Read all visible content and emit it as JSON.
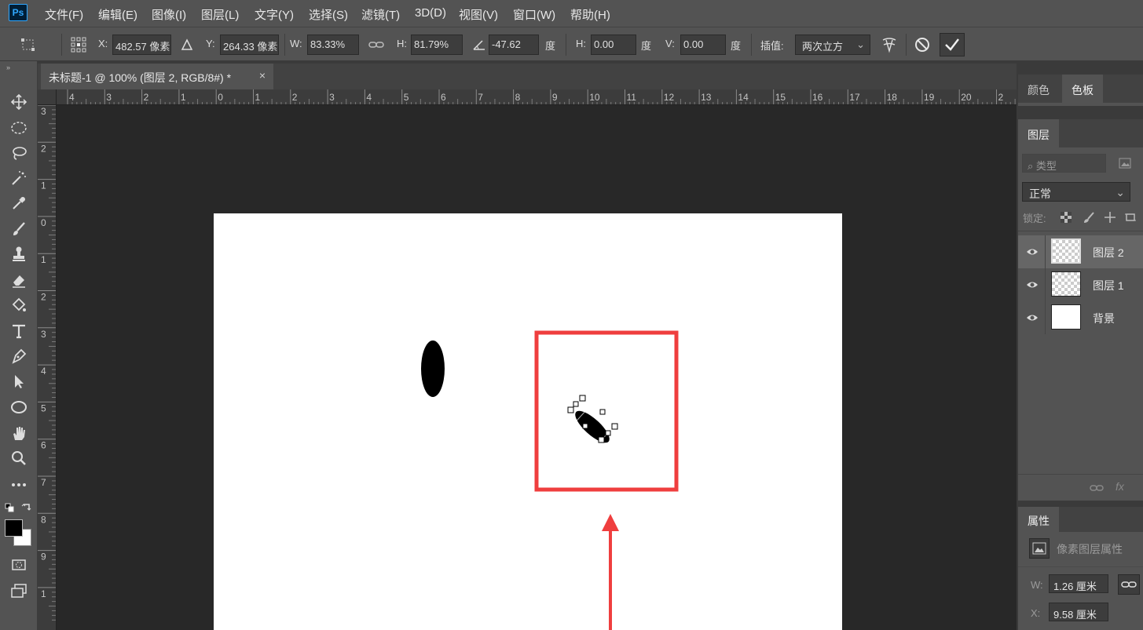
{
  "app": {
    "logo": "Ps"
  },
  "menu": [
    "文件(F)",
    "编辑(E)",
    "图像(I)",
    "图层(L)",
    "文字(Y)",
    "选择(S)",
    "滤镜(T)",
    "3D(D)",
    "视图(V)",
    "窗口(W)",
    "帮助(H)"
  ],
  "options": {
    "x_label": "X:",
    "x_value": "482.57 像素",
    "y_label": "Y:",
    "y_value": "264.33 像素",
    "w_label": "W:",
    "w_value": "83.33%",
    "h_label": "H:",
    "h_value": "81.79%",
    "angle_value": "-47.62",
    "angle_unit": "度",
    "skew_h_label": "H:",
    "skew_h_value": "0.00",
    "skew_h_unit": "度",
    "skew_v_label": "V:",
    "skew_v_value": "0.00",
    "skew_v_unit": "度",
    "interp_label": "插值:",
    "interp_value": "两次立方"
  },
  "document_tab": {
    "title": "未标题-1 @ 100% (图层 2, RGB/8#) *",
    "close": "×"
  },
  "ruler_h": [
    "4",
    "3",
    "2",
    "1",
    "0",
    "1",
    "2",
    "3",
    "4",
    "5",
    "6",
    "7",
    "8",
    "9",
    "10",
    "11",
    "12",
    "13",
    "14",
    "15",
    "16",
    "17",
    "18",
    "19",
    "20",
    "2"
  ],
  "ruler_v": [
    "3",
    "2",
    "1",
    "0",
    "1",
    "2",
    "3",
    "4",
    "5",
    "6",
    "7",
    "8",
    "9",
    "1"
  ],
  "panels": {
    "color_tabs": [
      "颜色",
      "色板"
    ],
    "layers_tab": "图层",
    "filter_placeholder": "类型",
    "blend_mode": "正常",
    "lock_label": "锁定:",
    "layers": [
      {
        "name": "图层 2",
        "selected": true,
        "thumb": "transparent"
      },
      {
        "name": "图层 1",
        "selected": false,
        "thumb": "transparent"
      },
      {
        "name": "背景",
        "selected": false,
        "thumb": "white"
      }
    ],
    "properties_tab": "属性",
    "properties_title": "像素图层属性",
    "w_label": "W:",
    "w_value": "1.26 厘米",
    "x_label": "X:",
    "x_value": "9.58 厘米"
  },
  "colors": {
    "annotation_red": "#ef3e3e",
    "foreground": "#000000",
    "background": "#ffffff"
  }
}
